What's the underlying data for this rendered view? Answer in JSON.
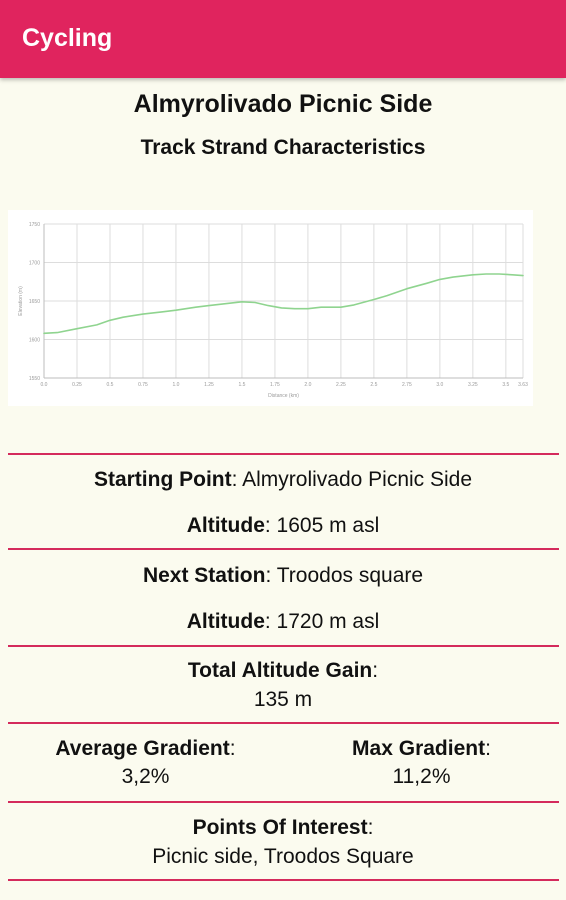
{
  "app_bar": {
    "title": "Cycling"
  },
  "header": {
    "title": "Almyrolivado Picnic Side",
    "subtitle": "Track Strand Characteristics"
  },
  "chart_data": {
    "type": "line",
    "xlabel": "Distance (km)",
    "ylabel": "Elevation (m)",
    "x_ticks": [
      "0.0",
      "0.25",
      "0.5",
      "0.75",
      "1.0",
      "1.25",
      "1.5",
      "1.75",
      "2.0",
      "2.25",
      "2.5",
      "2.75",
      "3.0",
      "3.25",
      "3.5",
      "3.63"
    ],
    "y_ticks": [
      "1550",
      "1600",
      "1650",
      "1700",
      "1750"
    ],
    "ylim": [
      1550,
      1750
    ],
    "x": [
      0.0,
      0.1,
      0.25,
      0.4,
      0.5,
      0.6,
      0.75,
      0.9,
      1.0,
      1.15,
      1.25,
      1.35,
      1.5,
      1.6,
      1.7,
      1.8,
      1.9,
      2.0,
      2.1,
      2.25,
      2.35,
      2.5,
      2.6,
      2.75,
      2.9,
      3.0,
      3.1,
      3.25,
      3.35,
      3.45,
      3.55,
      3.63
    ],
    "values": [
      1608,
      1609,
      1614,
      1619,
      1625,
      1629,
      1633,
      1636,
      1638,
      1642,
      1644,
      1646,
      1649,
      1648,
      1644,
      1641,
      1640,
      1640,
      1642,
      1642,
      1645,
      1652,
      1657,
      1666,
      1673,
      1678,
      1681,
      1684,
      1685,
      1685,
      1684,
      1683
    ],
    "grid": true,
    "line_color": "#8fd48f"
  },
  "details": {
    "start_label": "Starting Point",
    "start_value": ": Almyrolivado Picnic Side",
    "alt1_label": "Altitude",
    "alt1_value": ": 1605 m asl",
    "next_label": "Next Station",
    "next_value": ": Troodos square",
    "alt2_label": "Altitude",
    "alt2_value": ": 1720 m asl",
    "gain_label": "Total Altitude Gain",
    "gain_colon": ":",
    "gain_value": "135 m",
    "avg_label": "Average Gradient",
    "avg_colon": ":",
    "avg_value": "3,2%",
    "max_label": "Max Gradient",
    "max_colon": ":",
    "max_value": "11,2%",
    "poi_label": "Points Of Interest",
    "poi_colon": ":",
    "poi_value": "Picnic side, Troodos Square"
  }
}
